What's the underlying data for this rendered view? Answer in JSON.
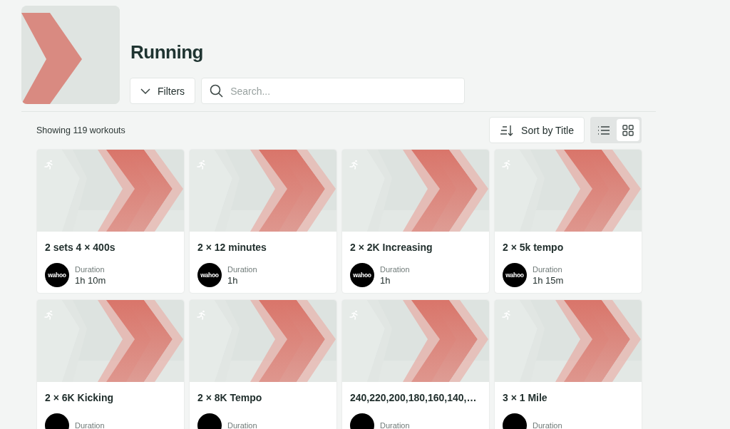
{
  "header": {
    "title": "Running"
  },
  "filters_button": {
    "label": "Filters"
  },
  "search": {
    "placeholder": "Search..."
  },
  "results_count": "Showing 119 workouts",
  "sort_button": {
    "label": "Sort by Title"
  },
  "view_options": [
    {
      "kind": "list",
      "selected": false
    },
    {
      "kind": "grid",
      "selected": true
    }
  ],
  "workouts": [
    {
      "title": "2 sets 4 × 400s",
      "logo": "wahoo",
      "duration_label": "Duration",
      "duration": "1h 10m"
    },
    {
      "title": "2 × 12 minutes",
      "logo": "wahoo",
      "duration_label": "Duration",
      "duration": "1h"
    },
    {
      "title": "2 × 2K Increasing",
      "logo": "wahoo",
      "duration_label": "Duration",
      "duration": "1h"
    },
    {
      "title": "2 × 5k tempo",
      "logo": "wahoo",
      "duration_label": "Duration",
      "duration": "1h 15m"
    },
    {
      "title": "2 × 6K Kicking",
      "duration_label": "Duration"
    },
    {
      "title": "2 × 8K Tempo",
      "duration_label": "Duration"
    },
    {
      "title": "240,220,200,180,160,140,…",
      "duration_label": "Duration"
    },
    {
      "title": "3 × 1 Mile",
      "duration_label": "Duration"
    }
  ]
}
